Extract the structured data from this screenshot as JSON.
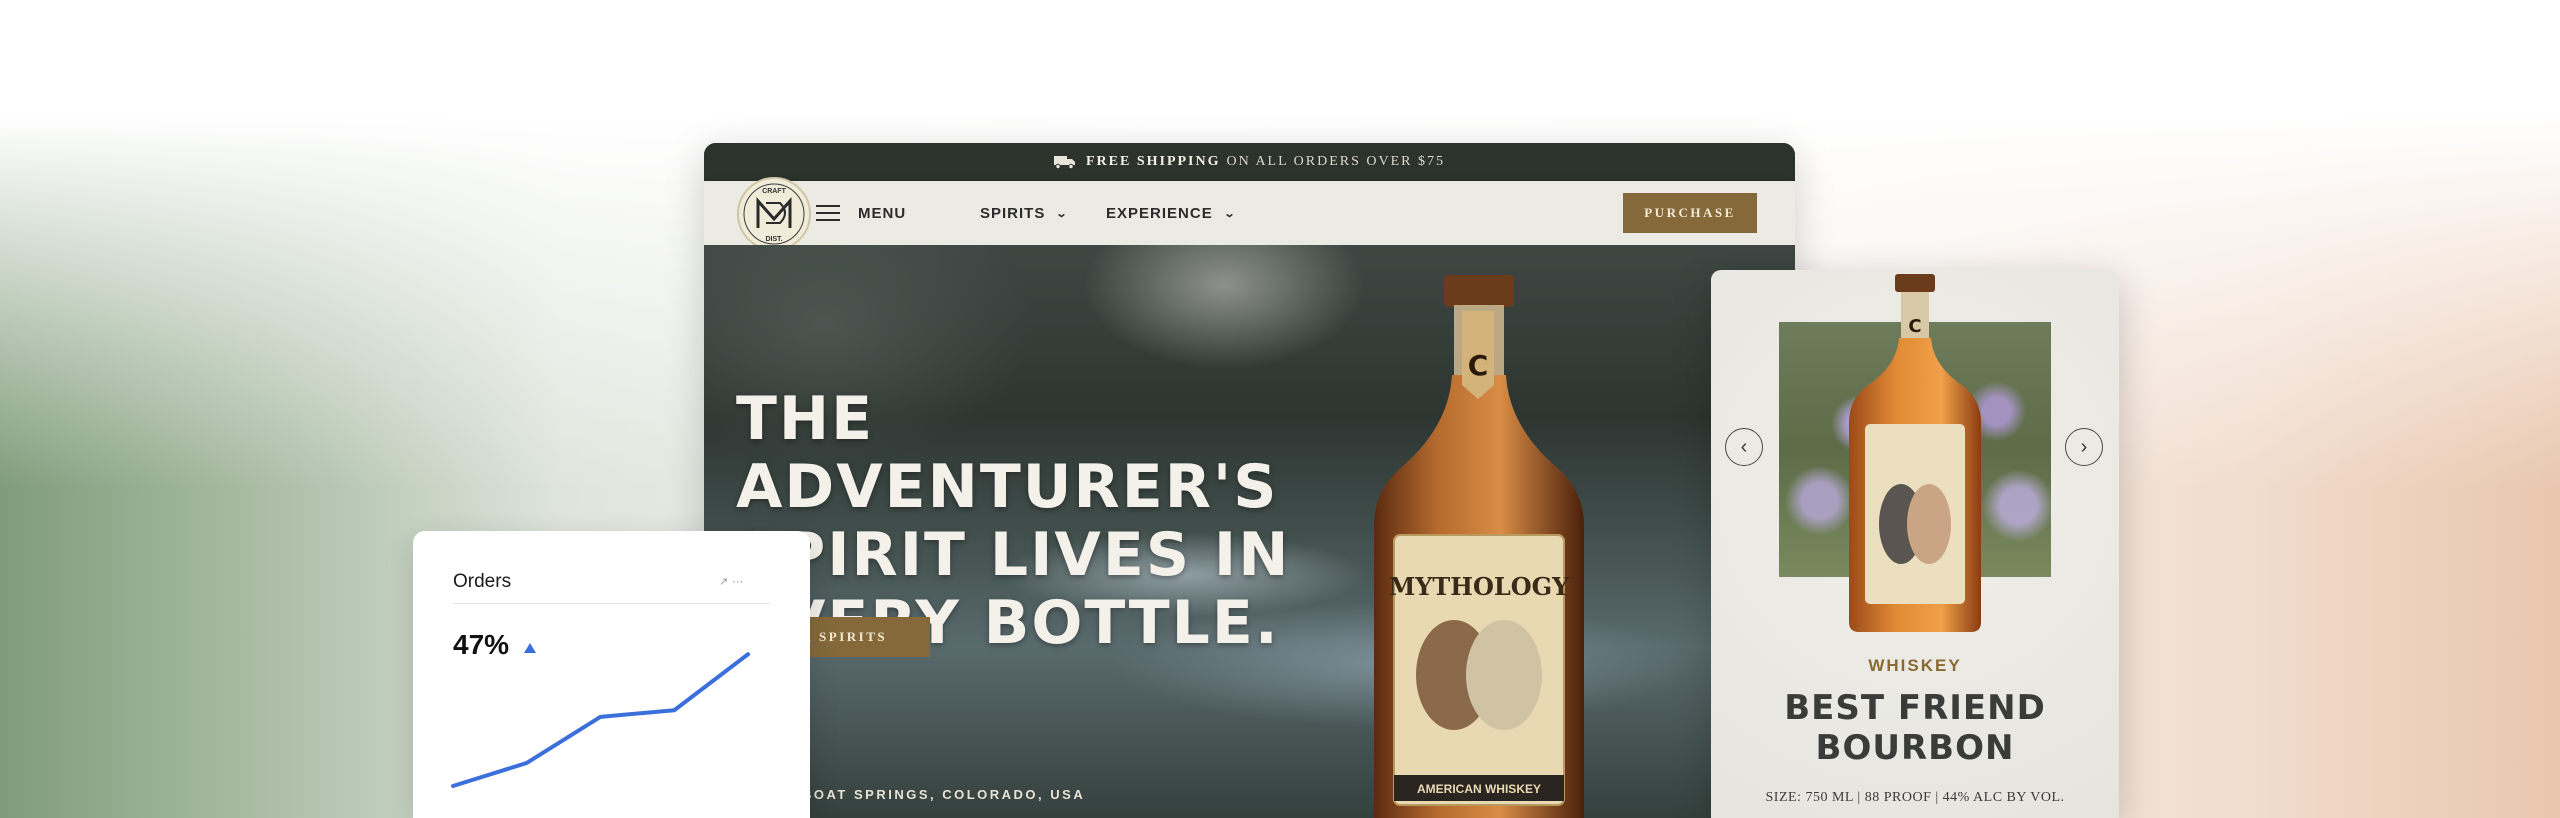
{
  "site": {
    "shipping": {
      "strong": "FREE SHIPPING",
      "rest": "ON ALL ORDERS OVER $75"
    },
    "logo": {
      "top": "CRAFT",
      "bottom": "DIST."
    },
    "nav": {
      "menu_label": "MENU",
      "spirits_label": "SPIRITS",
      "experience_label": "EXPERIENCE",
      "purchase_label": "PURCHASE"
    },
    "hero": {
      "headline_1": "THE ADVENTURER'S",
      "headline_2": "SPIRIT LIVES IN",
      "headline_3": "EVERY BOTTLE.",
      "cta_label": "OUR SPIRITS",
      "location": "STEAMBOAT SPRINGS, COLORADO, USA",
      "bottle_label_brand": "MYTHOLOGY",
      "bottle_label_type": "AMERICAN WHISKEY"
    }
  },
  "product_card": {
    "category": "WHISKEY",
    "name_line1": "BEST FRIEND",
    "name_line2": "BOURBON",
    "details": "SIZE: 750 ML | 88 PROOF | 44% ALC BY VOL."
  },
  "orders_widget": {
    "title": "Orders",
    "value": "47%",
    "trend": "up",
    "accent": "#3a6fdc"
  },
  "chart_data": {
    "type": "line",
    "series": [
      {
        "values": [
          0,
          1.4,
          4.2,
          4.6,
          8.0
        ]
      }
    ],
    "ylim": [
      0,
      8.5
    ]
  },
  "colors": {
    "gold": "#85693a",
    "dark_bar": "#2c332c",
    "nav_bg": "#ecebe3"
  }
}
